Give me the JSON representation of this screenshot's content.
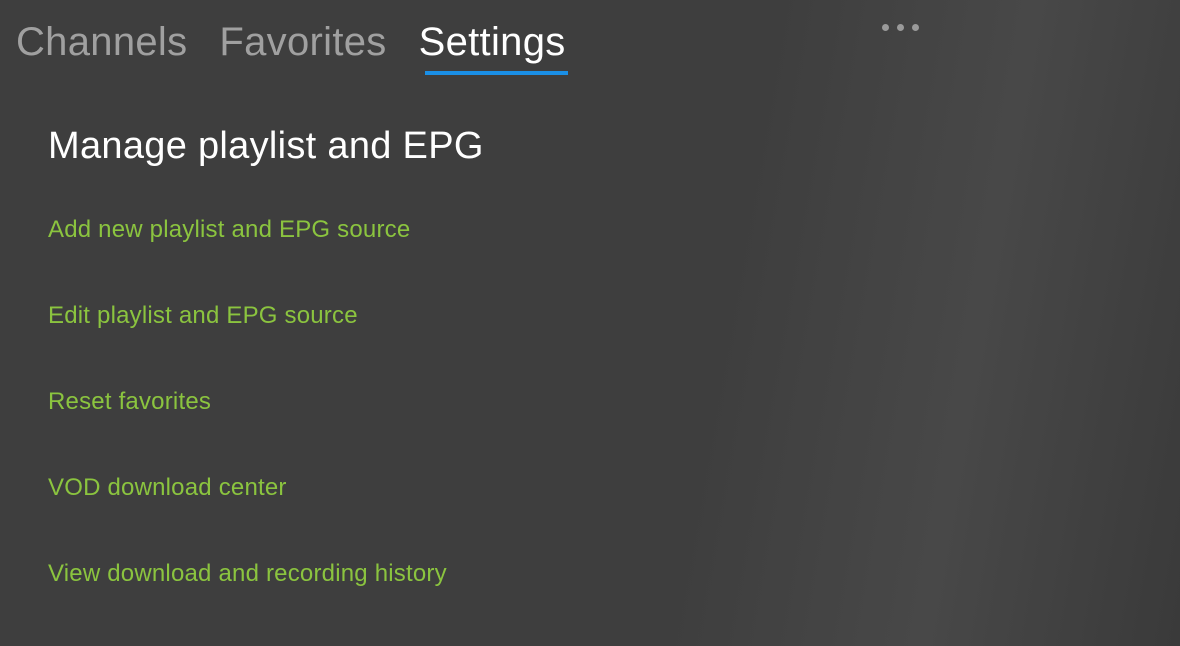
{
  "tabs": {
    "channels": "Channels",
    "favorites": "Favorites",
    "settings": "Settings"
  },
  "page": {
    "title": "Manage playlist and EPG"
  },
  "menu": {
    "items": [
      {
        "label": "Add new playlist and EPG source"
      },
      {
        "label": "Edit playlist and EPG source"
      },
      {
        "label": "Reset favorites"
      },
      {
        "label": "VOD download center"
      },
      {
        "label": "View download and recording history"
      }
    ]
  }
}
